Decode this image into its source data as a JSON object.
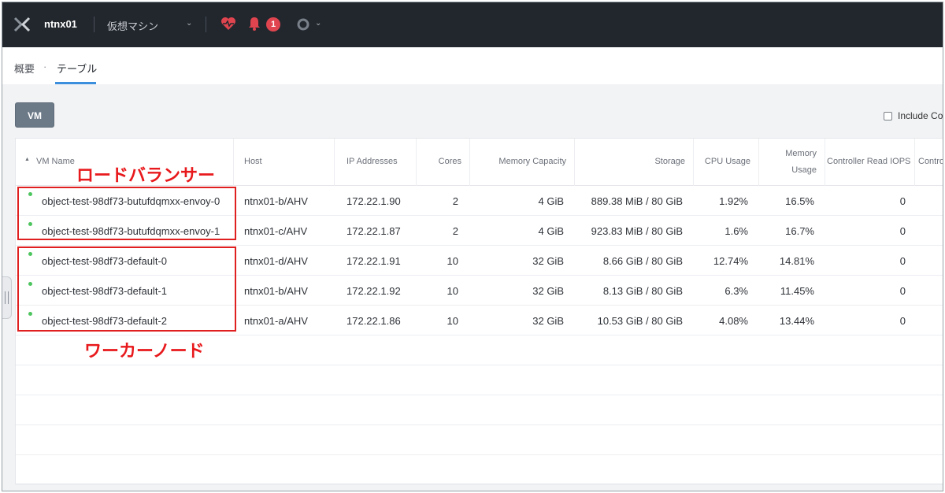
{
  "header": {
    "cluster_name": "ntnx01",
    "entity_selector": "仮想マシン",
    "alert_count": "1"
  },
  "tabs": [
    {
      "label": "概要"
    },
    {
      "label": "テーブル"
    }
  ],
  "tab_separator": "·",
  "toolbar": {
    "vm_button": "VM",
    "include_label": "Include Co"
  },
  "table": {
    "sort_indicator": "▲",
    "columns": {
      "vm_name": "VM Name",
      "host": "Host",
      "ip": "IP Addresses",
      "cores": "Cores",
      "memory": "Memory Capacity",
      "storage": "Storage",
      "cpu": "CPU Usage",
      "memory_usage_1": "Memory",
      "memory_usage_2": "Usage",
      "read_iops": "Controller Read IOPS",
      "next": "Contro"
    },
    "rows": [
      {
        "name": "object-test-98df73-butufdqmxx-envoy-0",
        "host": "ntnx01-b/AHV",
        "ip": "172.22.1.90",
        "cores": "2",
        "memory": "4 GiB",
        "storage": "889.38 MiB / 80 GiB",
        "cpu": "1.92%",
        "mem_usage": "16.5%",
        "read_iops": "0"
      },
      {
        "name": "object-test-98df73-butufdqmxx-envoy-1",
        "host": "ntnx01-c/AHV",
        "ip": "172.22.1.87",
        "cores": "2",
        "memory": "4 GiB",
        "storage": "923.83 MiB / 80 GiB",
        "cpu": "1.6%",
        "mem_usage": "16.7%",
        "read_iops": "0"
      },
      {
        "name": "object-test-98df73-default-0",
        "host": "ntnx01-d/AHV",
        "ip": "172.22.1.91",
        "cores": "10",
        "memory": "32 GiB",
        "storage": "8.66 GiB / 80 GiB",
        "cpu": "12.74%",
        "mem_usage": "14.81%",
        "read_iops": "0"
      },
      {
        "name": "object-test-98df73-default-1",
        "host": "ntnx01-b/AHV",
        "ip": "172.22.1.92",
        "cores": "10",
        "memory": "32 GiB",
        "storage": "8.13 GiB / 80 GiB",
        "cpu": "6.3%",
        "mem_usage": "11.45%",
        "read_iops": "0"
      },
      {
        "name": "object-test-98df73-default-2",
        "host": "ntnx01-a/AHV",
        "ip": "172.22.1.86",
        "cores": "10",
        "memory": "32 GiB",
        "storage": "10.53 GiB / 80 GiB",
        "cpu": "4.08%",
        "mem_usage": "13.44%",
        "read_iops": "0"
      }
    ]
  },
  "annotations": {
    "load_balancer": "ロードバランサー",
    "worker_node": "ワーカーノード",
    "color": "#e8191c"
  },
  "colors": {
    "topbar": "#22272e",
    "accent": "#3b8fdc",
    "status_green": "#4dc55e",
    "alert_red": "#e0454f"
  }
}
